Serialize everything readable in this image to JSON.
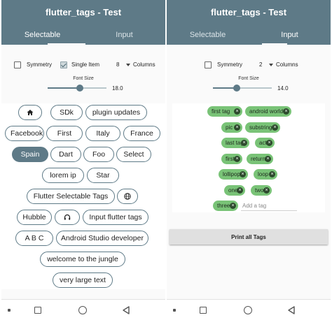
{
  "app": {
    "title": "flutter_tags - Test"
  },
  "tabs": [
    {
      "label": "Selectable"
    },
    {
      "label": "Input"
    }
  ],
  "selectable_screen": {
    "options": {
      "symmetry_label": "Symmetry",
      "single_item_label": "Single Item",
      "columns_value": "8",
      "columns_label": "Columns"
    },
    "font_size": {
      "label": "Font Size",
      "value": "18.0",
      "fraction": 0.55
    },
    "tags": [
      {
        "icon": "home-icon",
        "active": false
      },
      {
        "label": "SDk",
        "active": false
      },
      {
        "label": "plugin updates",
        "active": false
      },
      {
        "label": "Facebook",
        "active": false
      },
      {
        "label": "First",
        "active": false
      },
      {
        "label": "Italy",
        "active": false
      },
      {
        "label": "France",
        "active": false
      },
      {
        "label": "Spain",
        "active": true
      },
      {
        "label": "Dart",
        "active": false
      },
      {
        "label": "Foo",
        "active": false
      },
      {
        "label": "Select",
        "active": false
      },
      {
        "label": "lorem ip",
        "active": false
      },
      {
        "label": "Star",
        "active": false
      },
      {
        "label": "Flutter Selectable Tags",
        "active": false
      },
      {
        "icon": "globe-icon",
        "active": false
      },
      {
        "label": "Hubble",
        "active": false
      },
      {
        "icon": "headphones-icon",
        "active": false
      },
      {
        "label": "Input flutter tags",
        "active": false
      },
      {
        "label": "A B C",
        "active": false
      },
      {
        "label": "Android Studio developer",
        "active": false
      },
      {
        "label": "welcome to the jungle",
        "active": false
      },
      {
        "label": "very large text",
        "active": false
      }
    ]
  },
  "input_screen": {
    "options": {
      "symmetry_label": "Symmetry",
      "columns_value": "2",
      "columns_label": "Columns"
    },
    "font_size": {
      "label": "Font Size",
      "value": "14.0",
      "fraction": 0.4
    },
    "tags": [
      "first tag",
      "android world",
      "pic",
      "substring",
      "last tag",
      "act",
      "first",
      "return",
      "lollipop",
      "loop",
      "one",
      "two",
      "three"
    ],
    "add_placeholder": "Add a tag",
    "print_button_label": "Print all Tags",
    "chip_color": "#79c377"
  },
  "colors": {
    "primary": "#5e7a87",
    "tag_green": "#79c377"
  }
}
